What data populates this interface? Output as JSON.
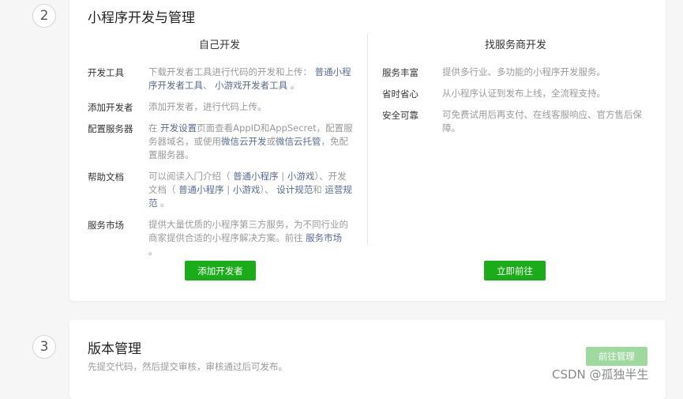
{
  "step2": {
    "number": "2",
    "title": "小程序开发与管理",
    "self_dev": {
      "heading": "自己开发",
      "rows": [
        {
          "label": "开发工具",
          "parts": [
            {
              "text": "下载开发者工具进行代码的开发和上传： "
            },
            {
              "text": "普通小程序开发者工具",
              "link": true
            },
            {
              "text": "、 "
            },
            {
              "text": "小游戏开发者工具",
              "link": true
            },
            {
              "text": " 。"
            }
          ]
        },
        {
          "label": "添加开发者",
          "parts": [
            {
              "text": "添加开发者，进行代码上传。"
            }
          ]
        },
        {
          "label": "配置服务器",
          "parts": [
            {
              "text": "在 "
            },
            {
              "text": "开发设置",
              "link": true
            },
            {
              "text": "页面查看AppID和AppSecret，配置服务器域名，或使用"
            },
            {
              "text": "微信云开发",
              "link": true
            },
            {
              "text": "或"
            },
            {
              "text": "微信云托管",
              "link": true
            },
            {
              "text": "，免配置服务器。"
            }
          ]
        },
        {
          "label": "帮助文档",
          "parts": [
            {
              "text": "可以阅读入门介绍（ "
            },
            {
              "text": "普通小程序",
              "link": true
            },
            {
              "text": " | "
            },
            {
              "text": "小游戏",
              "link": true
            },
            {
              "text": "）、开发文档（ "
            },
            {
              "text": "普通小程序",
              "link": true
            },
            {
              "text": " | "
            },
            {
              "text": "小游戏",
              "link": true
            },
            {
              "text": "）、 "
            },
            {
              "text": "设计规范",
              "link": true
            },
            {
              "text": "和 "
            },
            {
              "text": "运营规范",
              "link": true
            },
            {
              "text": " 。"
            }
          ]
        },
        {
          "label": "服务市场",
          "parts": [
            {
              "text": "提供大量优质的小程序第三方服务，为不同行业的商家提供合适的小程序解决方案。前往 "
            },
            {
              "text": "服务市场",
              "link": true
            },
            {
              "text": " 。"
            }
          ]
        }
      ],
      "button": "添加开发者"
    },
    "provider_dev": {
      "heading": "找服务商开发",
      "rows": [
        {
          "label": "服务丰富",
          "desc": "提供多行业、多功能的小程序开发服务。"
        },
        {
          "label": "省时省心",
          "desc": "从小程序认证到发布上线，全流程支持。"
        },
        {
          "label": "安全可靠",
          "desc": "可免费试用后再支付、在线客服响应、官方售后保障。"
        }
      ],
      "button": "立即前往"
    }
  },
  "step3": {
    "number": "3",
    "title": "版本管理",
    "subtitle": "先提交代码，然后提交审核，审核通过后可发布。",
    "button": "前往管理"
  },
  "watermark": "CSDN @孤独半生",
  "colors": {
    "primary_green": "#1aad19",
    "disabled_green": "#9ed99d",
    "link_blue": "#576b95"
  }
}
